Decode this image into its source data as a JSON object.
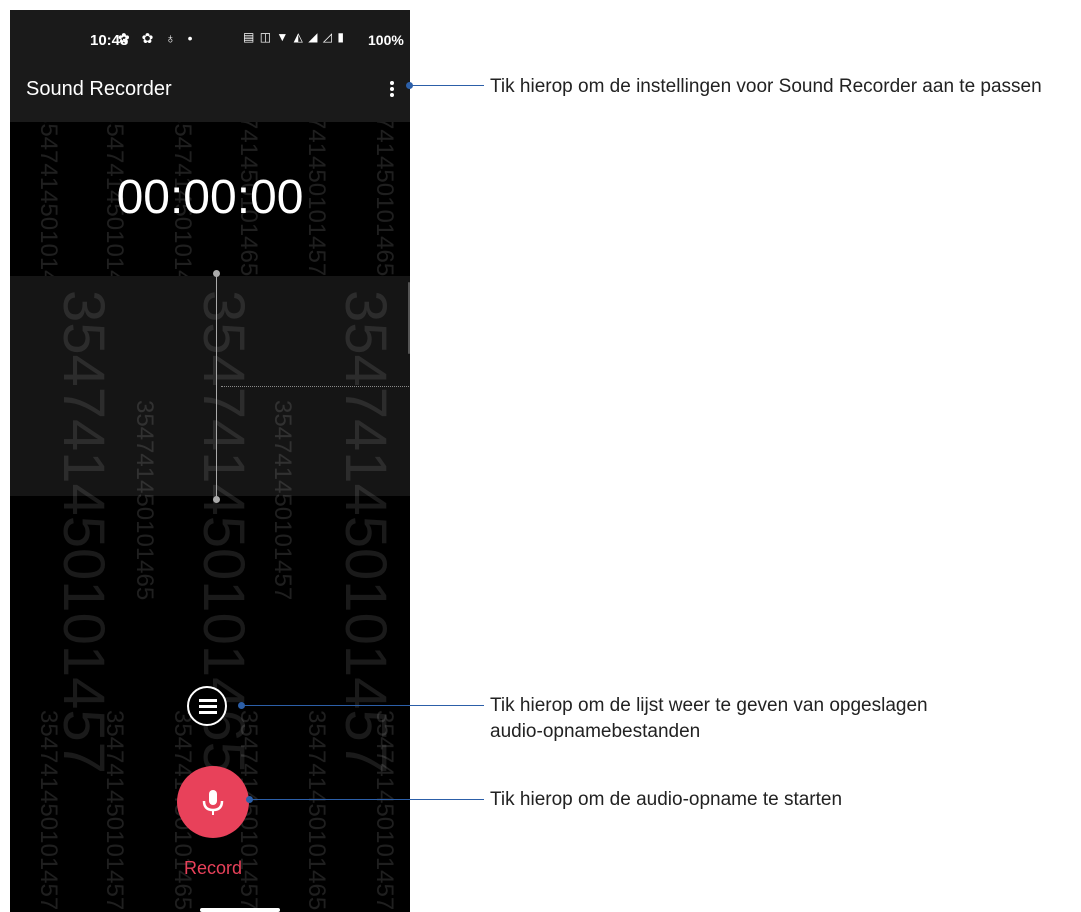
{
  "status_bar": {
    "time": "10:43",
    "icons": [
      "gear-icon",
      "gear-icon",
      "location-icon",
      "dot"
    ],
    "right_icons": [
      "nfc-icon",
      "vibrate-icon",
      "wifi-icon",
      "lte-icon",
      "signal-icon",
      "signal-off-icon"
    ],
    "battery": "100%"
  },
  "app_bar": {
    "title": "Sound Recorder",
    "menu_icon": "more-vert-icon"
  },
  "timer": "00:00:00",
  "watermark": {
    "long_a": "354741450101457",
    "long_b": "354741450101465"
  },
  "controls": {
    "list_icon": "list-icon",
    "record_icon": "mic-icon",
    "record_label": "Record"
  },
  "callouts": {
    "settings": "Tik hierop om de instellingen voor Sound Recorder aan te passen",
    "list_line1": "Tik hierop om de lijst weer te geven van opgeslagen",
    "list_line2": "audio-opnamebestanden",
    "record": "Tik hierop om de audio-opname te starten"
  },
  "colors": {
    "accent": "#e8415a",
    "callout_line": "#2c5fa8",
    "background": "#000000"
  }
}
